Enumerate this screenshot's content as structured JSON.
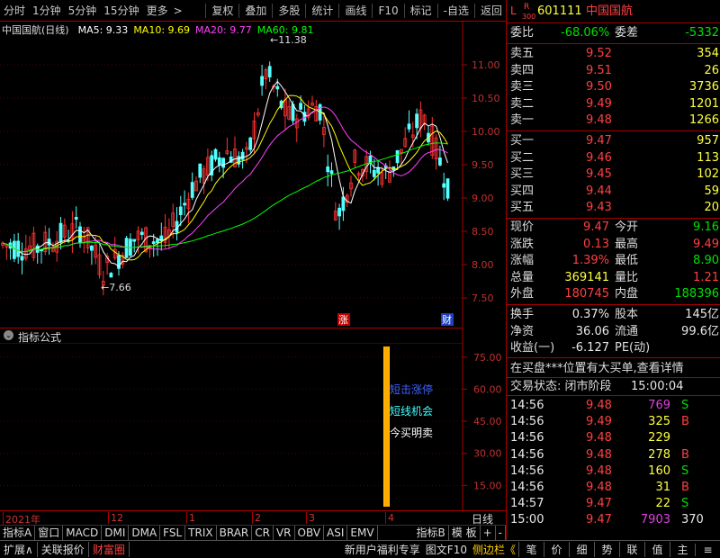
{
  "toolbar": {
    "left": [
      "分时",
      "1分钟",
      "5分钟",
      "15分钟",
      "更多"
    ],
    "right": [
      "复权",
      "叠加",
      "多股",
      "统计",
      "画线",
      "F10",
      "标记",
      "-自选",
      "返回"
    ],
    "more_glyph": ">"
  },
  "chart": {
    "title": "中国国航(日线)",
    "ma": [
      {
        "label": "MA5: 9.33",
        "color": "#ffffff"
      },
      {
        "label": "MA10: 9.69",
        "color": "#ffff00"
      },
      {
        "label": "MA20: 9.77",
        "color": "#ff40ff"
      },
      {
        "label": "MA60: 9.81",
        "color": "#00ff00"
      }
    ],
    "y_ticks": [
      "11.00",
      "10.50",
      "10.00",
      "9.50",
      "9.00",
      "8.50",
      "8.00",
      "7.50"
    ],
    "high_label": "11.38",
    "low_label": "7.66",
    "markers": [
      "涨",
      "财"
    ]
  },
  "indicator": {
    "header": "指标公式",
    "y_ticks": [
      "75.00",
      "60.00",
      "45.00",
      "30.00",
      "15.00"
    ],
    "texts": [
      {
        "t": "短击涨停",
        "color": "#4060ff"
      },
      {
        "t": "短线机会",
        "color": "#40ffff"
      },
      {
        "t": "今买明卖",
        "color": "#ffffff"
      }
    ]
  },
  "time_axis": {
    "labels": [
      "2021年",
      "12",
      "1",
      "2",
      "3",
      "4"
    ],
    "right": "日线"
  },
  "tabs": [
    "指标A",
    "窗口",
    "MACD",
    "DMI",
    "DMA",
    "FSL",
    "TRIX",
    "BRAR",
    "CR",
    "VR",
    "OBV",
    "ASI",
    "EMV",
    "指标B",
    "模 板",
    "+",
    "-"
  ],
  "status_left": [
    "扩展∧",
    "关联报价",
    "财富圈"
  ],
  "status_mid": [
    "新用户福利专享",
    "图文F10",
    "侧边栏《"
  ],
  "status_right": [
    "笔",
    "价",
    "细",
    "势",
    "联",
    "值",
    "主",
    "≡"
  ],
  "quote": {
    "badge_top": "R",
    "badge_bottom": "300",
    "badge_l": "L",
    "code": "601111",
    "name": "中国国航",
    "webi_label": "委比",
    "webi": "-68.06%",
    "weicha_label": "委差",
    "weicha": "-5332",
    "sells": [
      {
        "l": "卖五",
        "p": "9.52",
        "v": "354"
      },
      {
        "l": "卖四",
        "p": "9.51",
        "v": "26"
      },
      {
        "l": "卖三",
        "p": "9.50",
        "v": "3736"
      },
      {
        "l": "卖二",
        "p": "9.49",
        "v": "1201"
      },
      {
        "l": "卖一",
        "p": "9.48",
        "v": "1266"
      }
    ],
    "buys": [
      {
        "l": "买一",
        "p": "9.47",
        "v": "957"
      },
      {
        "l": "买二",
        "p": "9.46",
        "v": "113"
      },
      {
        "l": "买三",
        "p": "9.45",
        "v": "102"
      },
      {
        "l": "买四",
        "p": "9.44",
        "v": "59"
      },
      {
        "l": "买五",
        "p": "9.43",
        "v": "20"
      }
    ],
    "stats": [
      {
        "l1": "现价",
        "v1": "9.47",
        "c1": "red",
        "l2": "今开",
        "v2": "9.16",
        "c2": "green"
      },
      {
        "l1": "涨跌",
        "v1": "0.13",
        "c1": "red",
        "l2": "最高",
        "v2": "9.49",
        "c2": "red"
      },
      {
        "l1": "涨幅",
        "v1": "1.39%",
        "c1": "red",
        "l2": "最低",
        "v2": "8.90",
        "c2": "green"
      },
      {
        "l1": "总量",
        "v1": "369141",
        "c1": "yellow",
        "l2": "量比",
        "v2": "1.21",
        "c2": "red"
      },
      {
        "l1": "外盘",
        "v1": "180745",
        "c1": "red",
        "l2": "内盘",
        "v2": "188396",
        "c2": "green"
      }
    ],
    "stats2": [
      {
        "l1": "换手",
        "v1": "0.37%",
        "l2": "股本",
        "v2": "145亿"
      },
      {
        "l1": "净资",
        "v1": "36.06",
        "l2": "流通",
        "v2": "99.6亿"
      },
      {
        "l1": "收益(一)",
        "v1": "-6.127",
        "l2": "PE(动)",
        "v2": ""
      }
    ],
    "notice": "在买盘***位置有大买单,查看详情",
    "trade_state": "交易状态: 闭市阶段",
    "trade_time": "15:00:04",
    "ticks": [
      {
        "t": "14:56",
        "p": "9.48",
        "v": "769",
        "s": "S",
        "vc": "mag",
        "sc": "green"
      },
      {
        "t": "14:56",
        "p": "9.49",
        "v": "325",
        "s": "B",
        "vc": "yellow",
        "sc": "red"
      },
      {
        "t": "14:56",
        "p": "9.48",
        "v": "229",
        "s": "",
        "vc": "yellow",
        "sc": "white"
      },
      {
        "t": "14:56",
        "p": "9.48",
        "v": "278",
        "s": "B",
        "vc": "yellow",
        "sc": "red"
      },
      {
        "t": "14:56",
        "p": "9.48",
        "v": "160",
        "s": "S",
        "vc": "yellow",
        "sc": "green"
      },
      {
        "t": "14:56",
        "p": "9.48",
        "v": "31",
        "s": "B",
        "vc": "yellow",
        "sc": "red"
      },
      {
        "t": "14:57",
        "p": "9.47",
        "v": "22",
        "s": "S",
        "vc": "yellow",
        "sc": "green"
      },
      {
        "t": "15:00",
        "p": "9.47",
        "v": "7903",
        "s": "370",
        "vc": "mag",
        "sc": "white"
      }
    ]
  }
}
